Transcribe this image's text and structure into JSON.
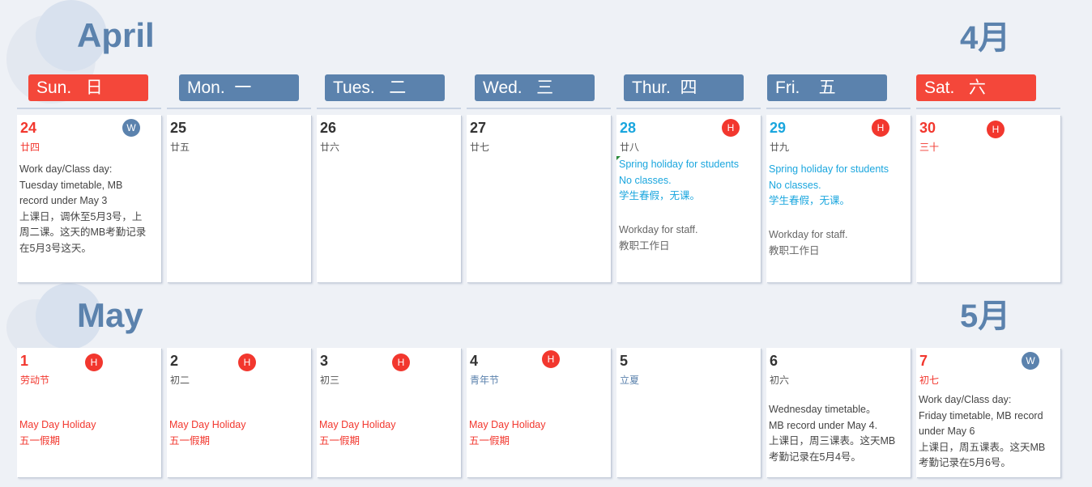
{
  "april": {
    "title": "April",
    "cn": "4月"
  },
  "may": {
    "title": "May",
    "cn": "5月"
  },
  "headers": [
    {
      "label": "Sun.   日",
      "color": "red"
    },
    {
      "label": "Mon.  一",
      "color": "blue"
    },
    {
      "label": "Tues.   二",
      "color": "blue"
    },
    {
      "label": "Wed.   三",
      "color": "blue"
    },
    {
      "label": "Thur.  四",
      "color": "blue"
    },
    {
      "label": "Fri.    五",
      "color": "blue"
    },
    {
      "label": "Sat.   六",
      "color": "red"
    }
  ],
  "badges": {
    "holiday": "H",
    "workday": "W"
  },
  "week1": [
    {
      "num": "24",
      "lunar": "廿四",
      "badge": "W",
      "note1": "Work day/Class day:\nTuesday timetable, MB\nrecord under May 3\n上课日，调休至5月3号，上\n周二课。这天的MB考勤记录\n在5月3号这天。"
    },
    {
      "num": "25",
      "lunar": "廿五"
    },
    {
      "num": "26",
      "lunar": "廿六"
    },
    {
      "num": "27",
      "lunar": "廿七"
    },
    {
      "num": "28",
      "lunar": "廿八",
      "badge": "H",
      "note1": "Spring holiday for students\nNo classes.\n学生春假，无课。",
      "note2": "Workday for staff.\n教职工作日"
    },
    {
      "num": "29",
      "lunar": "廿九",
      "badge": "H",
      "note1": "Spring holiday for students\nNo classes.\n学生春假，无课。",
      "note2": "Workday for staff.\n教职工作日"
    },
    {
      "num": "30",
      "lunar": "三十",
      "badge": "H"
    }
  ],
  "week2": [
    {
      "num": "1",
      "lunar": "劳动节",
      "badge": "H",
      "note1": "May Day Holiday\n五一假期"
    },
    {
      "num": "2",
      "lunar": "初二",
      "badge": "H",
      "note1": "May Day Holiday\n五一假期"
    },
    {
      "num": "3",
      "lunar": "初三",
      "badge": "H",
      "note1": "May Day Holiday\n五一假期"
    },
    {
      "num": "4",
      "lunar": "青年节",
      "badge": "H",
      "note1": "May Day Holiday\n五一假期"
    },
    {
      "num": "5",
      "lunar": "立夏"
    },
    {
      "num": "6",
      "lunar": "初六",
      "note1": "Wednesday timetable。\nMB record under May 4.\n上课日，周三课表。这天MB\n考勤记录在5月4号。"
    },
    {
      "num": "7",
      "lunar": "初七",
      "badge": "W",
      "note1": "Work day/Class day:\nFriday timetable, MB record\nunder May 6\n上课日，周五课表。这天MB\n考勤记录在5月6号。"
    }
  ],
  "colors": {
    "accent_blue": "#5b82ad",
    "accent_red": "#f4473a",
    "holiday_cyan": "#1aa6de",
    "background": "#eef1f6"
  }
}
